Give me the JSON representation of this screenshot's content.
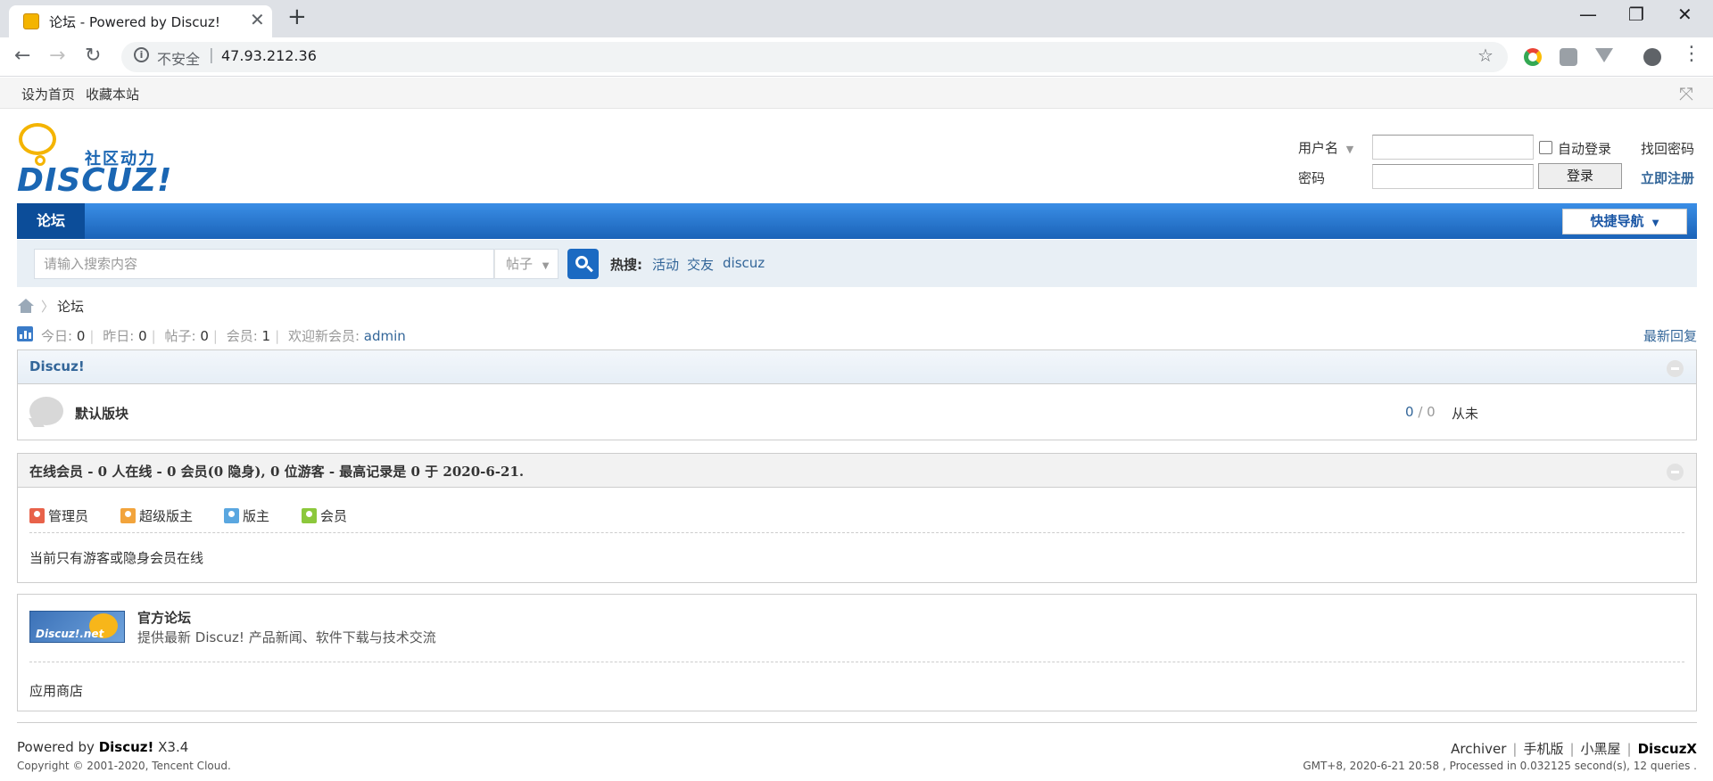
{
  "browser": {
    "tab_title": "论坛 - Powered by Discuz!",
    "close_glyph": "✕",
    "newtab_glyph": "+",
    "insecure_label": "不安全",
    "url": "47.93.212.36",
    "win_min": "—",
    "win_max": "❐",
    "win_close": "✕"
  },
  "topbar": {
    "set_homepage": "设为首页",
    "bookmark": "收藏本站"
  },
  "logo": {
    "sub": "社区动力",
    "main": "DISCUZ!"
  },
  "login": {
    "username_label": "用户名",
    "password_label": "密码",
    "auto_login": "自动登录",
    "submit": "登录",
    "find_password": "找回密码",
    "register": "立即注册"
  },
  "nav": {
    "forum": "论坛",
    "quick_nav": "快捷导航"
  },
  "search": {
    "placeholder": "请输入搜索内容",
    "type": "帖子",
    "hot_label": "热搜:",
    "hot": [
      "活动",
      "交友",
      "discuz"
    ]
  },
  "breadcrumb": {
    "current": "论坛"
  },
  "stats": {
    "today_label": "今日:",
    "today": "0",
    "yesterday_label": "昨日:",
    "yesterday": "0",
    "posts_label": "帖子:",
    "posts": "0",
    "members_label": "会员:",
    "members": "1",
    "welcome_label": "欢迎新会员:",
    "newest_member": "admin",
    "latest_reply": "最新回复"
  },
  "category": {
    "title": "Discuz!",
    "forum_name": "默认版块",
    "topics": "0",
    "slash": "/",
    "posts": "0",
    "last_post": "从未"
  },
  "online": {
    "title": "在线会员 - 0 人在线 - 0 会员(0 隐身), 0 位游客 - 最高记录是 0 于 2020-6-21.",
    "legend": [
      {
        "label": "管理员",
        "color": "#e8624a"
      },
      {
        "label": "超级版主",
        "color": "#f2a43c"
      },
      {
        "label": "版主",
        "color": "#5aa7e0"
      },
      {
        "label": "会员",
        "color": "#8cc83c"
      }
    ],
    "empty_text": "当前只有游客或隐身会员在线"
  },
  "links": {
    "logo_text": "Discuz!.net",
    "title": "官方论坛",
    "desc": "提供最新 Discuz! 产品新闻、软件下载与技术交流",
    "app_store": "应用商店"
  },
  "footer": {
    "powered_prefix": "Powered by ",
    "powered_brand": "Discuz!",
    "powered_version": " X3.4",
    "copyright": "Copyright © 2001-2020, Tencent Cloud.",
    "links": [
      "Archiver",
      "手机版",
      "小黑屋"
    ],
    "brand": "DiscuzX",
    "info": "GMT+8, 2020-6-21 20:58 , Processed in 0.032125 second(s), 12 queries ."
  }
}
